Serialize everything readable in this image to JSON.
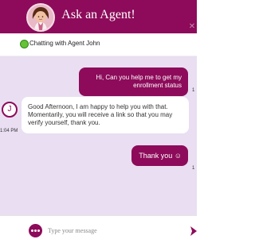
{
  "header": {
    "title": "Ask an Agent!",
    "avatar": "agent-avatar",
    "close_icon": "✕"
  },
  "status": {
    "text": "Chatting with Agent John",
    "color": "#66c236"
  },
  "messages": [
    {
      "sender": "user",
      "text": "Hi, Can you help me to get my enrollment status",
      "time": "1"
    },
    {
      "sender": "agent",
      "initial": "J",
      "text": "Good Afternoon, I am happy to help you with that. Momentarily, you will receive a link so that you may verify yourself, thank you.",
      "time": "1:04 PM"
    },
    {
      "sender": "user",
      "text": "Thank you ☺",
      "time": "1"
    }
  ],
  "composer": {
    "placeholder": "Type your message",
    "more_icon": "dots-icon",
    "send_icon": "send-icon"
  },
  "colors": {
    "brand": "#8d0b5a",
    "chat_background": "#e9def2",
    "user_bubble": "#8d0b5a",
    "agent_bubble": "#ffffff",
    "online_status": "#66c236"
  }
}
